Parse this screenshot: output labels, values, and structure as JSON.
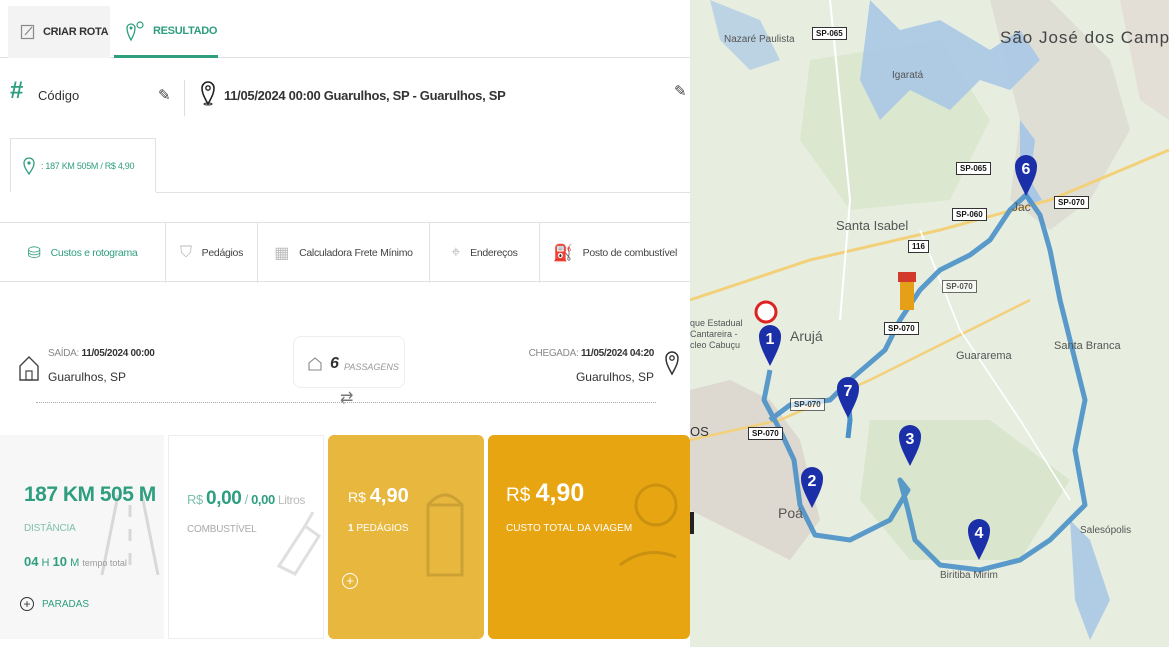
{
  "tabs": {
    "criar_rota": "CRIAR ROTA",
    "resultado": "RESULTADO"
  },
  "header": {
    "codigo_label": "Código",
    "route_info": "11/05/2024 00:00 Guarulhos, SP - Guarulhos, SP"
  },
  "route_chip": {
    "label": ": 187 KM 505M / R$ 4,90"
  },
  "sections": [
    {
      "label": "Custos e rotograma",
      "icon": "money-icon",
      "active": true
    },
    {
      "label": "Pedágios",
      "icon": "toll-icon",
      "active": false
    },
    {
      "label": "Calculadora Frete Mínimo",
      "icon": "calculator-icon",
      "active": false
    },
    {
      "label": "Endereços",
      "icon": "pin-icon",
      "active": false
    },
    {
      "label": "Posto de combustível",
      "icon": "fuel-icon",
      "active": false
    }
  ],
  "trip": {
    "saida_prefix": "SAÍDA:",
    "saida_datetime": "11/05/2024 00:00",
    "saida_city": "Guarulhos, SP",
    "passagens_count": "6",
    "passagens_label": "PASSAGENS",
    "chegada_prefix": "CHEGADA:",
    "chegada_datetime": "11/05/2024 04:20",
    "chegada_city": "Guarulhos, SP"
  },
  "cards": {
    "distance": {
      "value": "187 KM 505 M",
      "label": "DISTÂNCIA",
      "hours": "04",
      "h": "H",
      "minutes": "10",
      "m": "M",
      "time_label": "tempo total",
      "paradas": "PARADAS"
    },
    "fuel": {
      "currency": "R$",
      "value": "0,00",
      "slash": "/",
      "liters": "0,00",
      "liters_label": "Litros",
      "label": "COMBUSTÍVEL"
    },
    "tolls": {
      "currency": "R$",
      "value": "4,90",
      "count": "1",
      "label": "PEDÁGIOS"
    },
    "total": {
      "currency": "R$",
      "value": "4,90",
      "label": "CUSTO TOTAL DA VIAGEM"
    }
  },
  "map": {
    "places": {
      "nazare": "Nazaré Paulista",
      "sjc": "São José dos Campos",
      "igarata": "Igaratá",
      "santa_isabel": "Santa Isabel",
      "jacarei": "Jac",
      "aruja": "Arujá",
      "guararema": "Guararema",
      "santa_branca": "Santa Branca",
      "parque1": "que Estadual",
      "parque2": "Cantareira -",
      "parque3": "cleo Cabuçu",
      "os": "OS",
      "poa": "Poá",
      "biritiba": "Biritiba Mirim",
      "salesopolis": "Salesópolis"
    },
    "shields": {
      "sp065_top": "SP-065",
      "sp065_mid": "SP-065",
      "sp060": "SP-060",
      "sp070_right": "SP-070",
      "sp070_mid": "SP-070",
      "sp070_center": "SP-070",
      "sp070_left": "SP-070",
      "sp070_lower": "SP-070",
      "r116": "116"
    },
    "markers": [
      "1",
      "2",
      "3",
      "4",
      "6",
      "7"
    ],
    "route_color": "#4a90c8",
    "marker_color": "#1b2fa8"
  }
}
